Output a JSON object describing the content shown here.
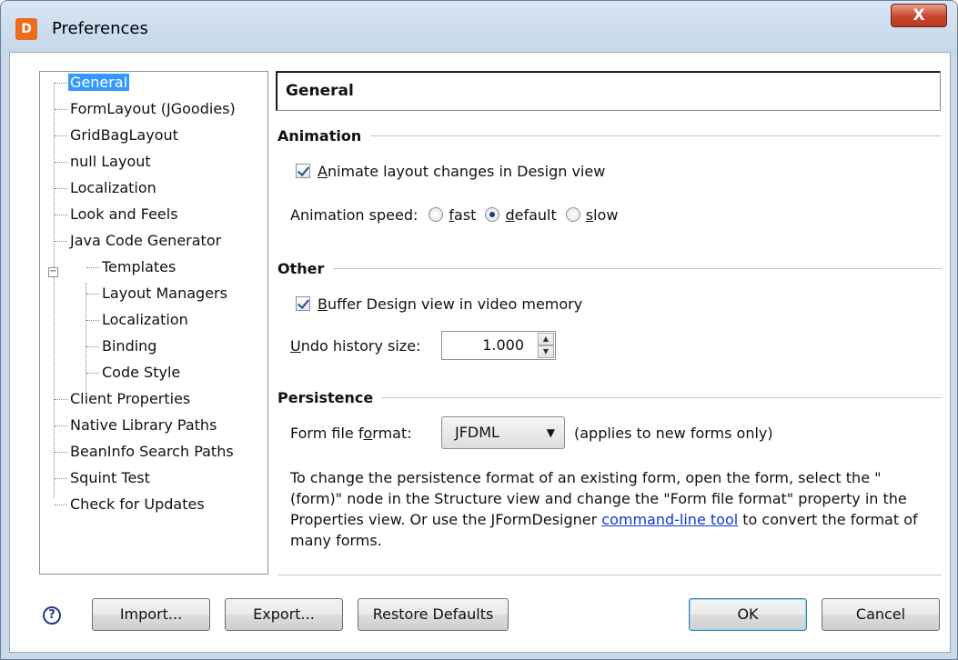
{
  "window": {
    "title": "Preferences",
    "close_glyph": "X",
    "app_icon_glyph": "D"
  },
  "tree": {
    "items": [
      {
        "label": "General",
        "selected": true
      },
      {
        "label": "FormLayout (JGoodies)"
      },
      {
        "label": "GridBagLayout"
      },
      {
        "label": "null Layout"
      },
      {
        "label": "Localization"
      },
      {
        "label": "Look and Feels"
      },
      {
        "label": "Java Code Generator",
        "expanded": true
      },
      {
        "label": "Templates",
        "child": true
      },
      {
        "label": "Layout Managers",
        "child": true
      },
      {
        "label": "Localization",
        "child": true
      },
      {
        "label": "Binding",
        "child": true
      },
      {
        "label": "Code Style",
        "child": true
      },
      {
        "label": "Client Properties"
      },
      {
        "label": "Native Library Paths"
      },
      {
        "label": "BeanInfo Search Paths"
      },
      {
        "label": "Squint Test"
      },
      {
        "label": "Check for Updates"
      }
    ],
    "expander_glyph": "−"
  },
  "panel": {
    "title": "General",
    "animation": {
      "header": "Animation",
      "animate_checkbox_mnemonic": "A",
      "animate_checkbox_rest": "nimate layout changes in Design view",
      "speed_label": "Animation speed:",
      "fast_mnemonic": "f",
      "fast_rest": "ast",
      "default_mnemonic": "d",
      "default_rest": "efault",
      "slow_mnemonic": "s",
      "slow_rest": "low",
      "selected_speed": "default"
    },
    "other": {
      "header": "Other",
      "buffer_checkbox_mnemonic": "B",
      "buffer_checkbox_rest": "uffer Design view in video memory",
      "undo_label_mnemonic": "U",
      "undo_label_rest": "ndo history size:",
      "undo_value": "1.000"
    },
    "persistence": {
      "header": "Persistence",
      "format_label_pre": "Form file f",
      "format_label_mnemonic": "o",
      "format_label_post": "rmat:",
      "format_value": "JFDML",
      "format_note": "(applies to new forms only)",
      "info_text": "To change the persistence format of an existing form, open the form, select the \"(form)\" node in the Structure view and change the \"Form file format\" property in the Properties view. Or use the JFormDesigner ",
      "info_link": "command-line tool",
      "info_text_after": " to convert the format of many forms."
    }
  },
  "buttons": {
    "help": "?",
    "import": "Import...",
    "export": "Export...",
    "restore": "Restore Defaults",
    "ok": "OK",
    "cancel": "Cancel"
  },
  "colors": {
    "selection": "#3399ff",
    "link": "#0a39d6",
    "title_bar": "#c9d9ea",
    "close": "#c8442b"
  }
}
